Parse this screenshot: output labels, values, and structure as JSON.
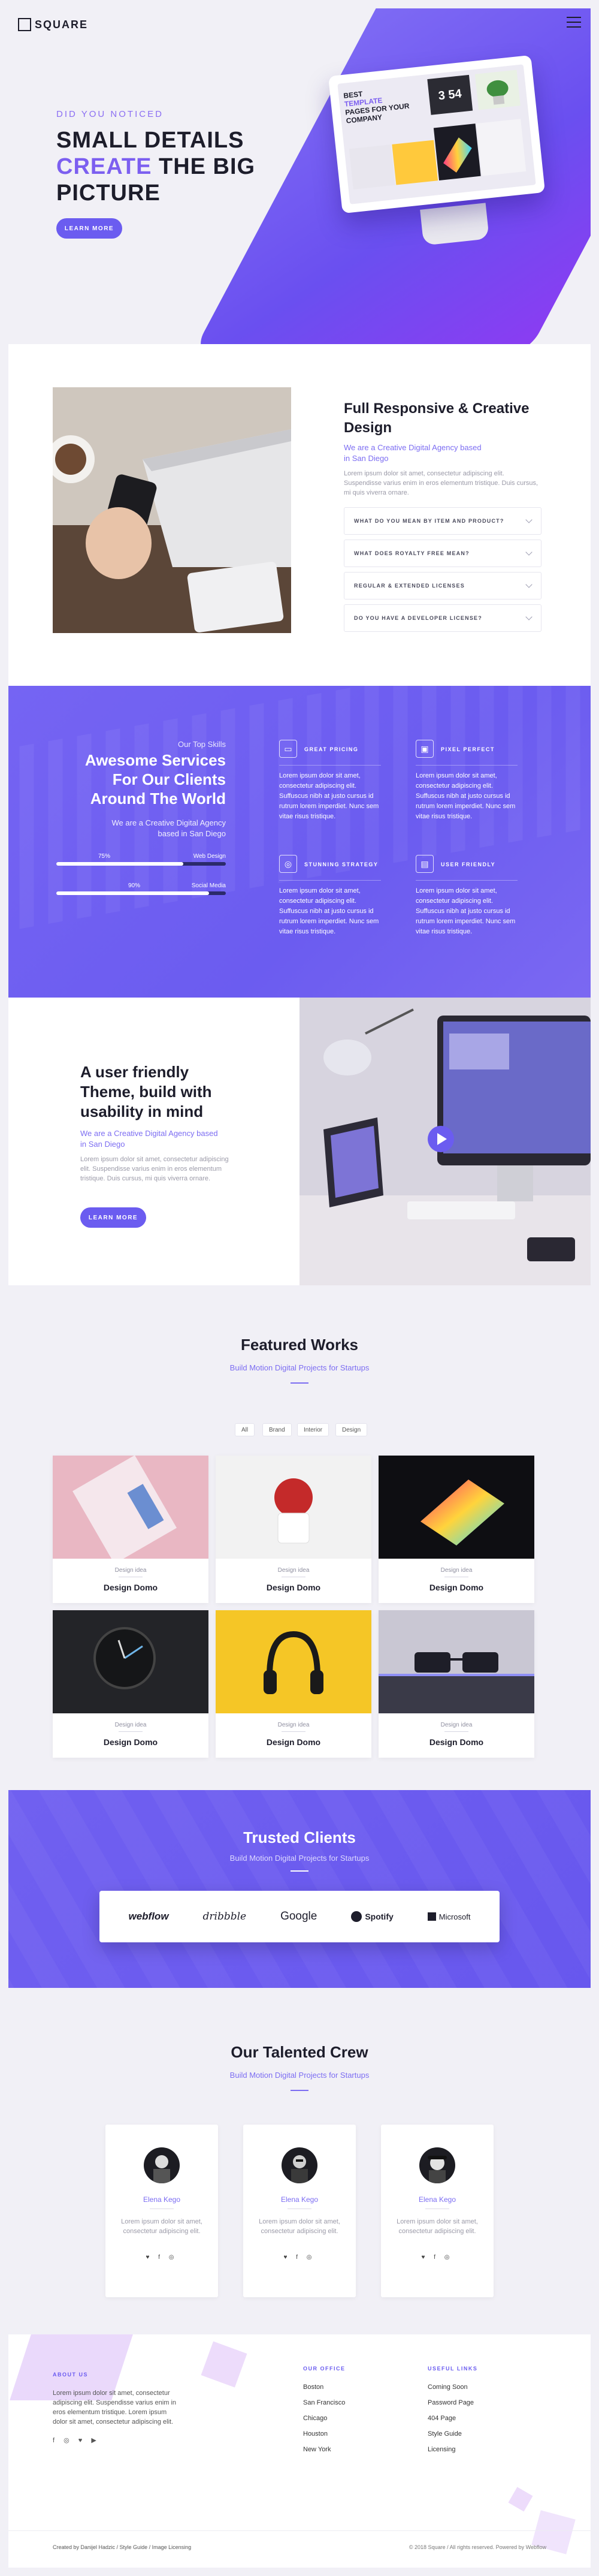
{
  "brand": {
    "logo_text": "SQUARE"
  },
  "hero": {
    "eyebrow": "DID YOU NOTICED",
    "title_line1": "SMALL DETAILS",
    "title_highlight": "CREATE",
    "title_line2_rest": " THE BIG",
    "title_line3": "PICTURE",
    "button": "LEARN MORE",
    "monitor_text_a": "BEST",
    "monitor_text_b": "TEMPLATE",
    "monitor_text_c": "PAGES FOR YOUR",
    "monitor_text_d": "COMPANY",
    "monitor_clock": "3 54"
  },
  "about": {
    "title": "Full Responsive & Creative Design",
    "subtitle": "We are a Creative Digital Agency based in San Diego",
    "text": "Lorem ipsum dolor sit amet, consectetur adipiscing elit. Suspendisse varius enim in eros elementum tristique. Duis cursus, mi quis viverra ornare.",
    "faq": [
      "WHAT DO YOU MEAN BY ITEM AND PRODUCT?",
      "WHAT DOES ROYALTY FREE MEAN?",
      "REGULAR & EXTENDED LICENSES",
      "DO YOU HAVE A DEVELOPER LICENSE?"
    ]
  },
  "services": {
    "eyebrow": "Our Top Skills",
    "title": "Awesome Services For Our Clients Around The World",
    "subtitle": "We are a Creative Digital Agency based in San Diego",
    "skills": [
      {
        "percent": "75%",
        "label": "Web Design",
        "fill": 0.75
      },
      {
        "percent": "90%",
        "label": "Social Media",
        "fill": 0.9
      }
    ],
    "features": [
      {
        "title": "GREAT PRICING",
        "icon": "credit-card-icon",
        "text": "Lorem ipsum dolor sit amet, consectetur adipiscing elit. Suffuscus nibh at justo cursus id rutrum lorem imperdiet. Nunc sem vitae risus tristique."
      },
      {
        "title": "PIXEL PERFECT",
        "icon": "browser-icon",
        "text": "Lorem ipsum dolor sit amet, consectetur adipiscing elit. Suffuscus nibh at justo cursus id rutrum lorem imperdiet. Nunc sem vitae risus tristique."
      },
      {
        "title": "STUNNING STRATEGY",
        "icon": "target-icon",
        "text": "Lorem ipsum dolor sit amet, consectetur adipiscing elit. Suffuscus nibh at justo cursus id rutrum lorem imperdiet. Nunc sem vitae risus tristique."
      },
      {
        "title": "USER FRIENDLY",
        "icon": "device-icon",
        "text": "Lorem ipsum dolor sit amet, consectetur adipiscing elit. Suffuscus nibh at justo cursus id rutrum lorem imperdiet. Nunc sem vitae risus tristique."
      }
    ]
  },
  "theme": {
    "title": "A user friendly Theme, build with usability in mind",
    "subtitle": "We are a Creative Digital Agency based in San Diego",
    "text": "Lorem ipsum dolor sit amet, consectetur adipiscing elit. Suspendisse varius enim in eros elementum tristique. Duis cursus, mi quis viverra ornare.",
    "button": "LEARN MORE"
  },
  "works": {
    "title": "Featured Works",
    "subtitle": "Build Motion Digital Projects for Startups",
    "filters": [
      "All",
      "Brand",
      "Interior",
      "Design"
    ],
    "items": [
      {
        "category": "Design idea",
        "title": "Design Domo"
      },
      {
        "category": "Design idea",
        "title": "Design Domo"
      },
      {
        "category": "Design idea",
        "title": "Design Domo"
      },
      {
        "category": "Design idea",
        "title": "Design Domo"
      },
      {
        "category": "Design idea",
        "title": "Design Domo"
      },
      {
        "category": "Design idea",
        "title": "Design Domo"
      }
    ]
  },
  "clients": {
    "title": "Trusted Clients",
    "subtitle": "Build Motion Digital Projects for Startups",
    "logos": [
      "webflow",
      "dribbble",
      "Google",
      "Spotify",
      "Microsoft"
    ]
  },
  "crew": {
    "title": "Our Talented Crew",
    "subtitle": "Build Motion Digital Projects for Startups",
    "members": [
      {
        "name": "Elena Kego",
        "text": "Lorem ipsum dolor sit amet, consectetur adipiscing elit.",
        "social": "♥ f ◎"
      },
      {
        "name": "Elena Kego",
        "text": "Lorem ipsum dolor sit amet, consectetur adipiscing elit.",
        "social": "♥ f ◎"
      },
      {
        "name": "Elena Kego",
        "text": "Lorem ipsum dolor sit amet, consectetur adipiscing elit.",
        "social": "♥ f ◎"
      }
    ]
  },
  "footer": {
    "about_head": "ABOUT US",
    "about_text": "Lorem ipsum dolor sit amet, consectetur adipiscing elit. Suspendisse varius enim in eros elementum tristique. Lorem ipsum dolor sit amet, consectetur adipiscing elit.",
    "about_social": "f ◎ ♥ ▶",
    "office_head": "OUR OFFICE",
    "offices": [
      "Boston",
      "San Francisco",
      "Chicago",
      "Houston",
      "New York"
    ],
    "links_head": "USEFUL LINKS",
    "links": [
      "Coming Soon",
      "Password Page",
      "404 Page",
      "Style Guide",
      "Licensing"
    ],
    "credits": "Created by Danijel Hadzic / Style Guide / Image Licensing",
    "copyright": "© 2018 Square / All rights reserved. Powered by Webflow"
  },
  "colors": {
    "accent": "#6b5cf0",
    "highlight": "#7c5ff0",
    "dark": "#1d1d2b"
  }
}
